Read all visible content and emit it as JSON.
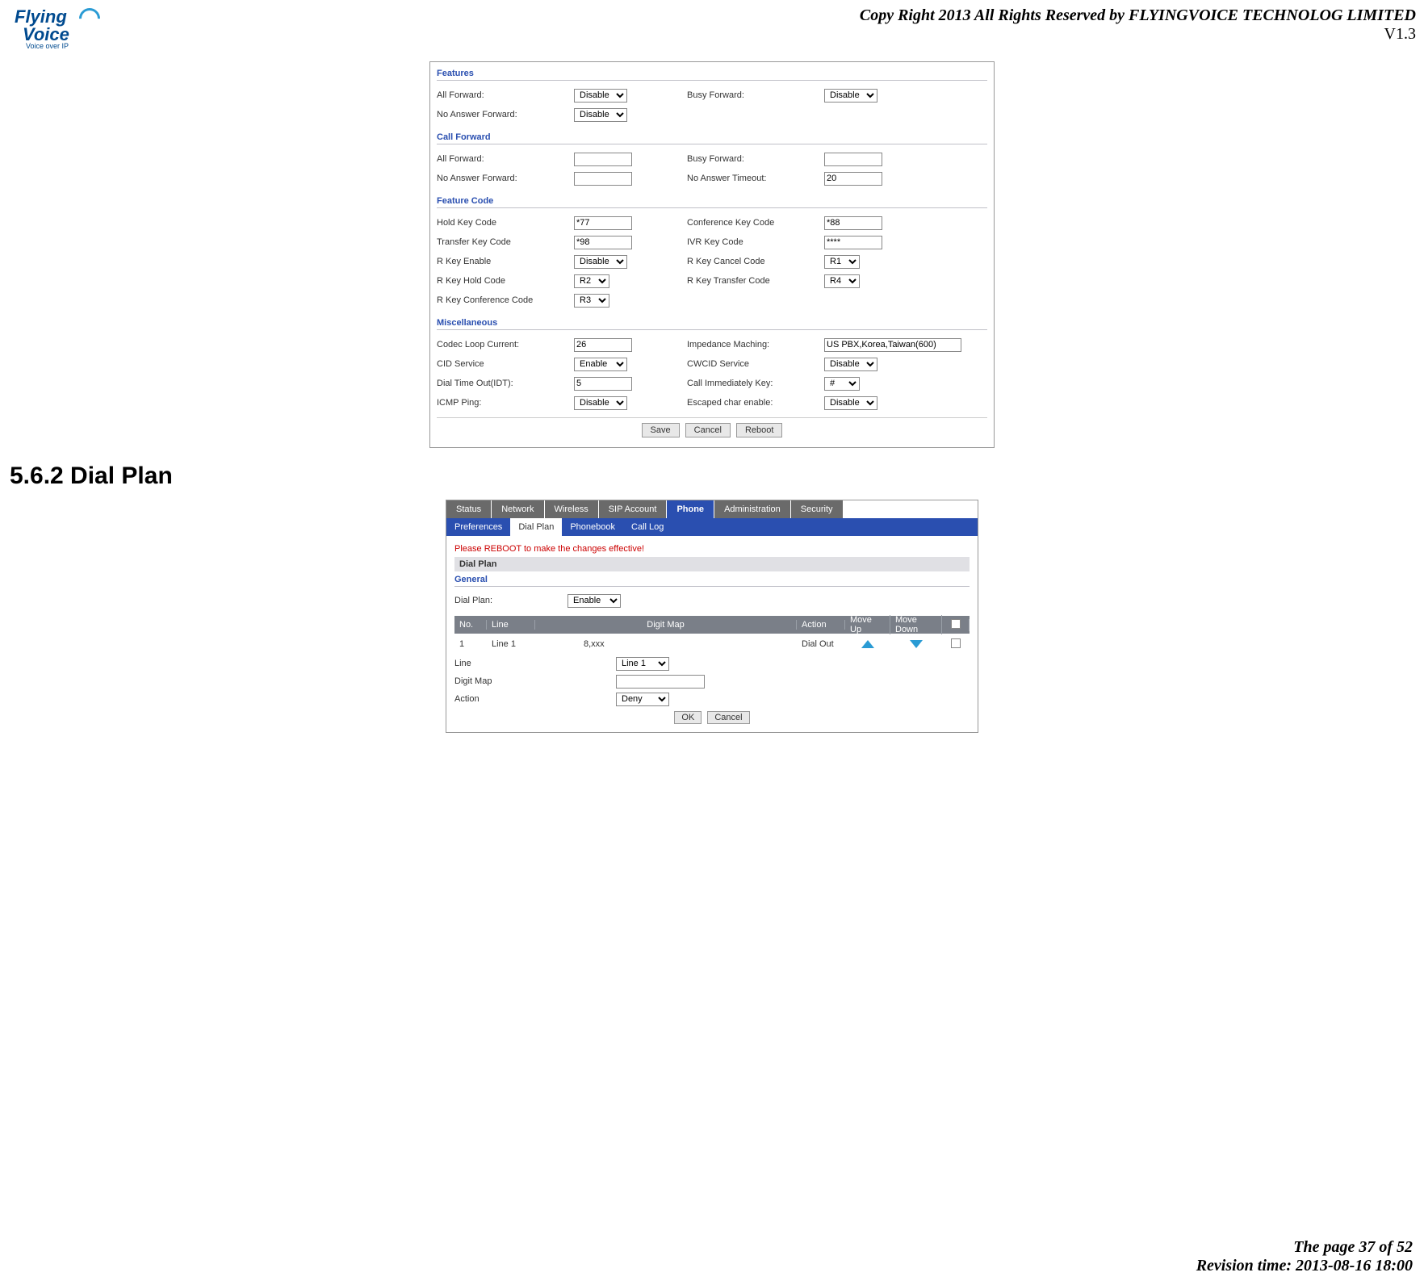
{
  "header": {
    "copyright": "Copy Right 2013 All Rights Reserved by FLYINGVOICE TECHNOLOG LIMITED",
    "version": "V1.3"
  },
  "logo": {
    "line1": "Flying",
    "line2": "Voice",
    "tagline": "Voice over IP"
  },
  "section_heading": "5.6.2 Dial Plan",
  "footer": {
    "page": "The page 37 of 52",
    "revision": "Revision time: 2013-08-16 18:00"
  },
  "s1": {
    "features": {
      "title": "Features",
      "all_fwd": "All Forward:",
      "all_fwd_val": "Disable",
      "busy_fwd": "Busy Forward:",
      "busy_fwd_val": "Disable",
      "no_ans_fwd": "No Answer Forward:",
      "no_ans_fwd_val": "Disable"
    },
    "call_forward": {
      "title": "Call Forward",
      "all_fwd": "All Forward:",
      "all_fwd_val": "",
      "busy_fwd": "Busy Forward:",
      "busy_fwd_val": "",
      "no_ans_fwd": "No Answer Forward:",
      "no_ans_fwd_val": "",
      "no_ans_timeout": "No Answer Timeout:",
      "no_ans_timeout_val": "20"
    },
    "feature_code": {
      "title": "Feature Code",
      "hold": "Hold Key Code",
      "hold_val": "*77",
      "conf": "Conference Key Code",
      "conf_val": "*88",
      "transfer": "Transfer Key Code",
      "transfer_val": "*98",
      "ivr": "IVR Key Code",
      "ivr_val": "****",
      "rkey_enable": "R Key Enable",
      "rkey_enable_val": "Disable",
      "rkey_cancel": "R Key Cancel Code",
      "rkey_cancel_val": "R1",
      "rkey_hold": "R Key Hold Code",
      "rkey_hold_val": "R2",
      "rkey_transfer": "R Key Transfer Code",
      "rkey_transfer_val": "R4",
      "rkey_conf": "R Key Conference Code",
      "rkey_conf_val": "R3"
    },
    "misc": {
      "title": "Miscellaneous",
      "codec": "Codec Loop Current:",
      "codec_val": "26",
      "imp": "Impedance Maching:",
      "imp_val": "US PBX,Korea,Taiwan(600)",
      "cid": "CID Service",
      "cid_val": "Enable",
      "cwcid": "CWCID Service",
      "cwcid_val": "Disable",
      "dto": "Dial Time Out(IDT):",
      "dto_val": "5",
      "cikey": "Call Immediately Key:",
      "cikey_val": "#",
      "icmp": "ICMP Ping:",
      "icmp_val": "Disable",
      "ece": "Escaped char enable:",
      "ece_val": "Disable"
    },
    "buttons": {
      "save": "Save",
      "cancel": "Cancel",
      "reboot": "Reboot"
    }
  },
  "s2": {
    "tabs": [
      "Status",
      "Network",
      "Wireless",
      "SIP Account",
      "Phone",
      "Administration",
      "Security"
    ],
    "active_tab": "Phone",
    "subtabs": [
      "Preferences",
      "Dial Plan",
      "Phonebook",
      "Call Log"
    ],
    "active_subtab": "Dial Plan",
    "warn": "Please REBOOT to make the changes effective!",
    "panel_title": "Dial Plan",
    "general": {
      "title": "General",
      "dial_plan": "Dial Plan:",
      "dial_plan_val": "Enable"
    },
    "table": {
      "headers": {
        "no": "No.",
        "line": "Line",
        "digit_map": "Digit Map",
        "action": "Action",
        "move_up": "Move Up",
        "move_down": "Move Down"
      },
      "rows": [
        {
          "no": "1",
          "line": "Line 1",
          "digit_map": "8,xxx",
          "action": "Dial Out"
        }
      ]
    },
    "form": {
      "line": "Line",
      "line_val": "Line 1",
      "digit_map": "Digit Map",
      "digit_map_val": "",
      "action": "Action",
      "action_val": "Deny",
      "ok": "OK",
      "cancel": "Cancel"
    }
  }
}
